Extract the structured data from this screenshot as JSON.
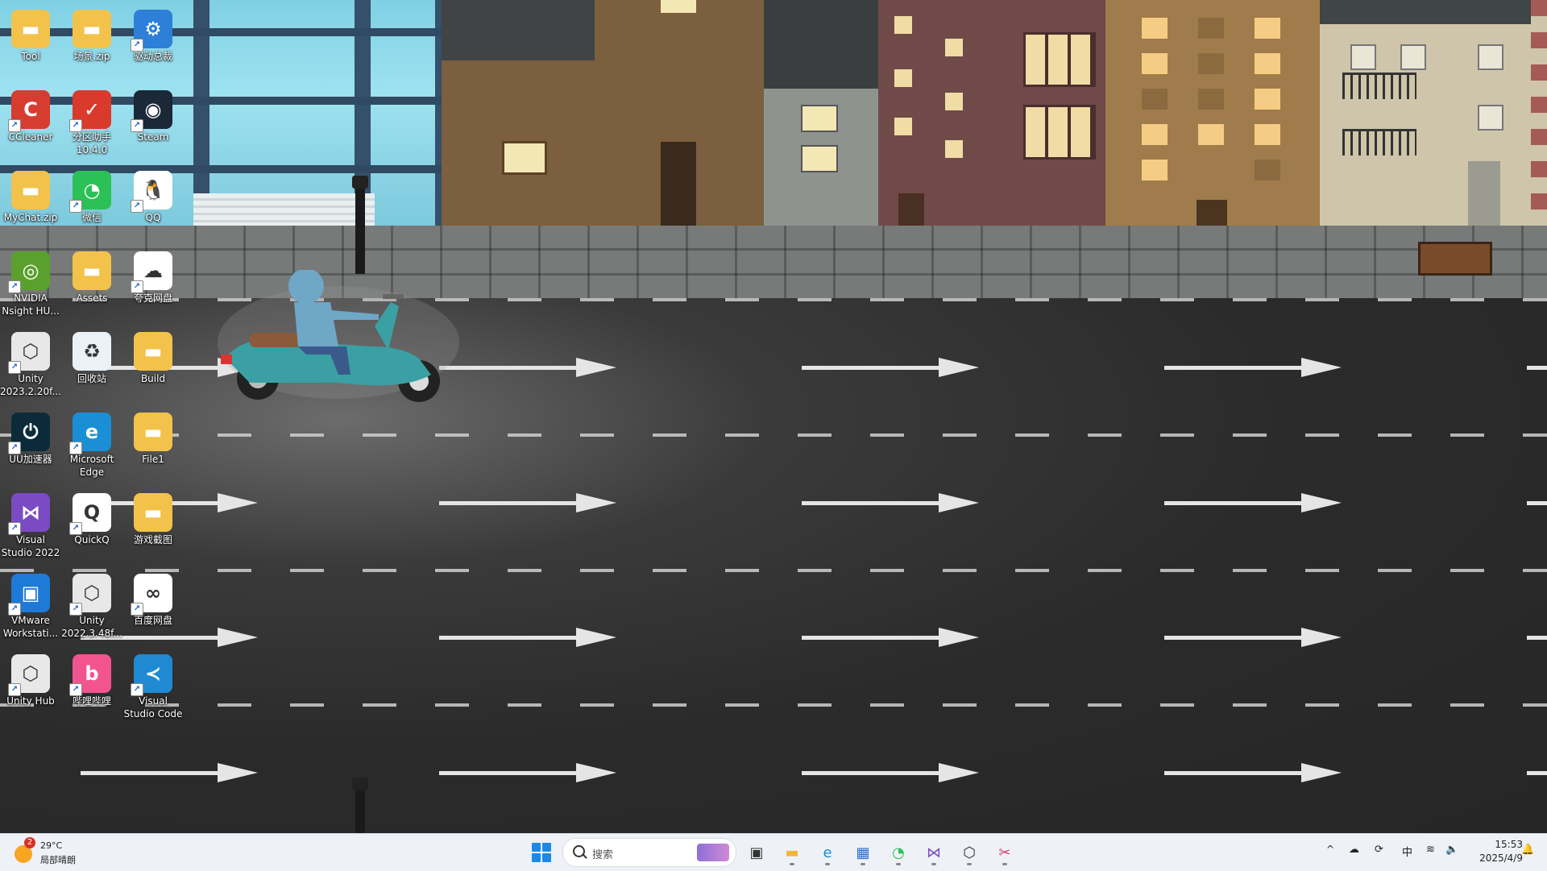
{
  "desktop": {
    "icons": [
      {
        "id": "tool",
        "label": "Tool",
        "color": "#f2c24b",
        "glyph": "▬",
        "shortcut": false
      },
      {
        "id": "scene-zip",
        "label": "场景.zip",
        "color": "#f2c24b",
        "glyph": "▬",
        "shortcut": false
      },
      {
        "id": "driver-master",
        "label": "驱动总裁",
        "color": "#2d7fd8",
        "glyph": "⚙",
        "shortcut": true
      },
      {
        "id": "ccleaner",
        "label": "CCleaner",
        "color": "#d63c2f",
        "glyph": "C",
        "shortcut": true
      },
      {
        "id": "partition-assistant",
        "label": "分区助手\n10.4.0",
        "color": "#d93a2c",
        "glyph": "✓",
        "shortcut": true
      },
      {
        "id": "steam",
        "label": "Steam",
        "color": "#1b2838",
        "glyph": "◉",
        "shortcut": true
      },
      {
        "id": "mychat-zip",
        "label": "MyChat.zip",
        "color": "#f2c24b",
        "glyph": "▬",
        "shortcut": false
      },
      {
        "id": "wechat",
        "label": "微信",
        "color": "#2bc157",
        "glyph": "◔",
        "shortcut": true
      },
      {
        "id": "qq",
        "label": "QQ",
        "color": "#ffffff",
        "glyph": "🐧",
        "shortcut": true
      },
      {
        "id": "nvidia-nsight",
        "label": "NVIDIA\nNsight HU...",
        "color": "#5aa02c",
        "glyph": "◎",
        "shortcut": true
      },
      {
        "id": "assets",
        "label": "Assets",
        "color": "#f2c24b",
        "glyph": "▬",
        "shortcut": false
      },
      {
        "id": "quark-drive",
        "label": "夸克网盘",
        "color": "#ffffff",
        "glyph": "☁",
        "shortcut": true
      },
      {
        "id": "unity-2023",
        "label": "Unity\n2023.2.20f...",
        "color": "#e8e8e8",
        "glyph": "⬡",
        "shortcut": true
      },
      {
        "id": "recycle-bin",
        "label": "回收站",
        "color": "#eaf2f8",
        "glyph": "♻",
        "shortcut": false
      },
      {
        "id": "build",
        "label": "Build",
        "color": "#f2c24b",
        "glyph": "▬",
        "shortcut": false
      },
      {
        "id": "uu-accelerator",
        "label": "UU加速器",
        "color": "#0c2b3a",
        "glyph": "⏻",
        "shortcut": true
      },
      {
        "id": "edge",
        "label": "Microsoft\nEdge",
        "color": "#1a8fd6",
        "glyph": "e",
        "shortcut": true
      },
      {
        "id": "file1",
        "label": "File1",
        "color": "#f2c24b",
        "glyph": "▬",
        "shortcut": false
      },
      {
        "id": "visual-studio",
        "label": "Visual\nStudio 2022",
        "color": "#7b4bc3",
        "glyph": "⋈",
        "shortcut": true
      },
      {
        "id": "quickq",
        "label": "QuickQ",
        "color": "#ffffff",
        "glyph": "Q",
        "shortcut": true
      },
      {
        "id": "game-screenshots",
        "label": "游戏截图",
        "color": "#f2c24b",
        "glyph": "▬",
        "shortcut": false
      },
      {
        "id": "vmware",
        "label": "VMware\nWorkstati...",
        "color": "#1e7ad6",
        "glyph": "▣",
        "shortcut": true
      },
      {
        "id": "unity-2022",
        "label": "Unity\n2022.3.48f...",
        "color": "#e8e8e8",
        "glyph": "⬡",
        "shortcut": true
      },
      {
        "id": "baidu-netdisk",
        "label": "百度网盘",
        "color": "#ffffff",
        "glyph": "∞",
        "shortcut": true
      },
      {
        "id": "unity-hub",
        "label": "Unity Hub",
        "color": "#e8e8e8",
        "glyph": "⬡",
        "shortcut": true
      },
      {
        "id": "bilibili",
        "label": "哔哩哔哩",
        "color": "#f2558d",
        "glyph": "b",
        "shortcut": true
      },
      {
        "id": "vscode",
        "label": "Visual\nStudio Code",
        "color": "#1f8ad2",
        "glyph": "≺",
        "shortcut": true
      }
    ]
  },
  "taskbar": {
    "weather": {
      "badge": "2",
      "temperature": "29°C",
      "condition": "局部晴朗"
    },
    "search_placeholder": "搜索",
    "apps": [
      {
        "id": "task-view",
        "glyph": "▣",
        "color": "#333333"
      },
      {
        "id": "file-explorer",
        "glyph": "▬",
        "color": "#f2b534"
      },
      {
        "id": "edge",
        "glyph": "e",
        "color": "#1a8fd6"
      },
      {
        "id": "microsoft-store",
        "glyph": "▦",
        "color": "#2b6cd4"
      },
      {
        "id": "wechat",
        "glyph": "◔",
        "color": "#2bc157"
      },
      {
        "id": "visual-studio",
        "glyph": "⋈",
        "color": "#7b4bc3"
      },
      {
        "id": "unity",
        "glyph": "⬡",
        "color": "#333333"
      },
      {
        "id": "snipping-tool",
        "glyph": "✂",
        "color": "#d93a6a"
      }
    ],
    "tray": {
      "chevron": "^",
      "ime": "中",
      "time": "15:53",
      "date": "2025/4/9"
    }
  }
}
